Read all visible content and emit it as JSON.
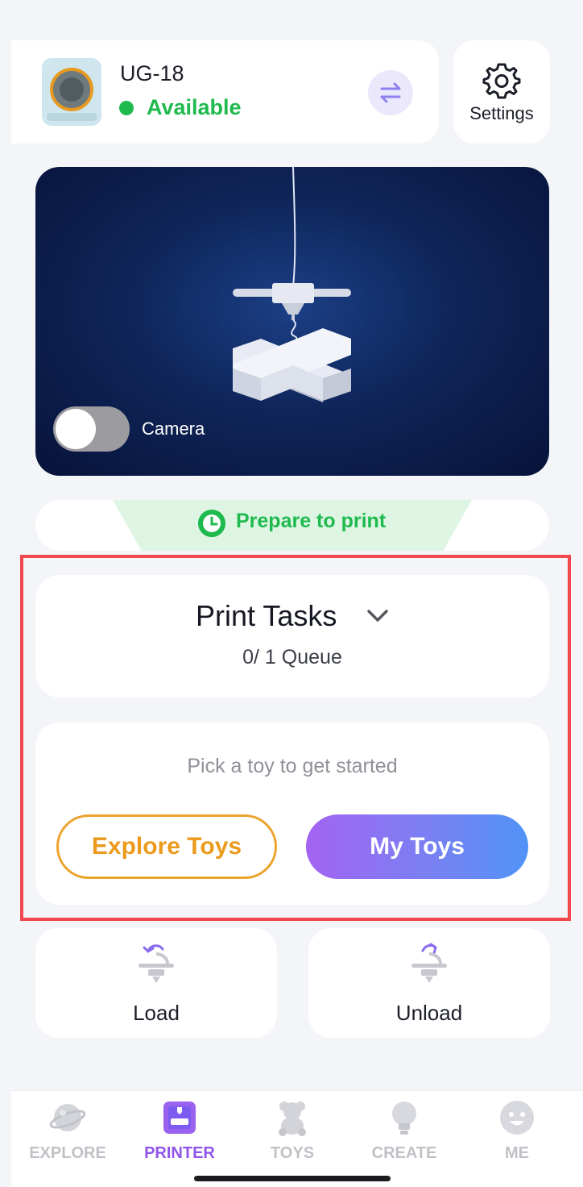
{
  "device": {
    "name": "UG-18",
    "status": "Available",
    "status_color": "#1fba4e"
  },
  "settings": {
    "label": "Settings"
  },
  "camera": {
    "label": "Camera",
    "enabled": false
  },
  "prepare": {
    "text": "Prepare to print"
  },
  "tasks": {
    "title": "Print Tasks",
    "queue": "0/ 1 Queue"
  },
  "empty": {
    "message": "Pick a toy to get started",
    "explore_label": "Explore Toys",
    "mytoys_label": "My Toys"
  },
  "actions": {
    "load_label": "Load",
    "unload_label": "Unload"
  },
  "nav": {
    "items": [
      {
        "label": "EXPLORE",
        "icon": "planet-icon"
      },
      {
        "label": "PRINTER",
        "icon": "printer-icon",
        "active": true
      },
      {
        "label": "TOYS",
        "icon": "bear-icon"
      },
      {
        "label": "CREATE",
        "icon": "lightbulb-icon"
      },
      {
        "label": "ME",
        "icon": "face-icon"
      }
    ]
  },
  "colors": {
    "accent_purple": "#8e55e8",
    "accent_orange": "#eb9a1c",
    "highlight": "#f2474d"
  }
}
